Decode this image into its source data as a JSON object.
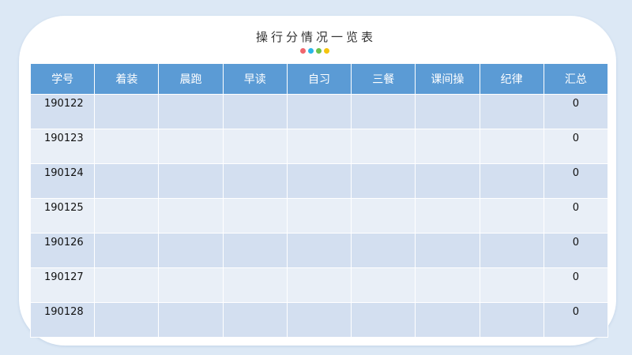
{
  "title": "操行分情况一览表",
  "dots": [
    "#f0666e",
    "#29b6e6",
    "#6dc24b",
    "#f5c40d"
  ],
  "table": {
    "headers": [
      "学号",
      "着装",
      "晨跑",
      "早读",
      "自习",
      "三餐",
      "课间操",
      "纪律",
      "汇总"
    ],
    "rows": [
      {
        "id": "190122",
        "total": "0"
      },
      {
        "id": "190123",
        "total": "0"
      },
      {
        "id": "190124",
        "total": "0"
      },
      {
        "id": "190125",
        "total": "0"
      },
      {
        "id": "190126",
        "total": "0"
      },
      {
        "id": "190127",
        "total": "0"
      },
      {
        "id": "190128",
        "total": "0"
      }
    ]
  },
  "colors": {
    "header_bg": "#5b9bd5",
    "row_odd": "#d3dff0",
    "row_even": "#e9eff7",
    "page_bg": "#dce8f5"
  }
}
